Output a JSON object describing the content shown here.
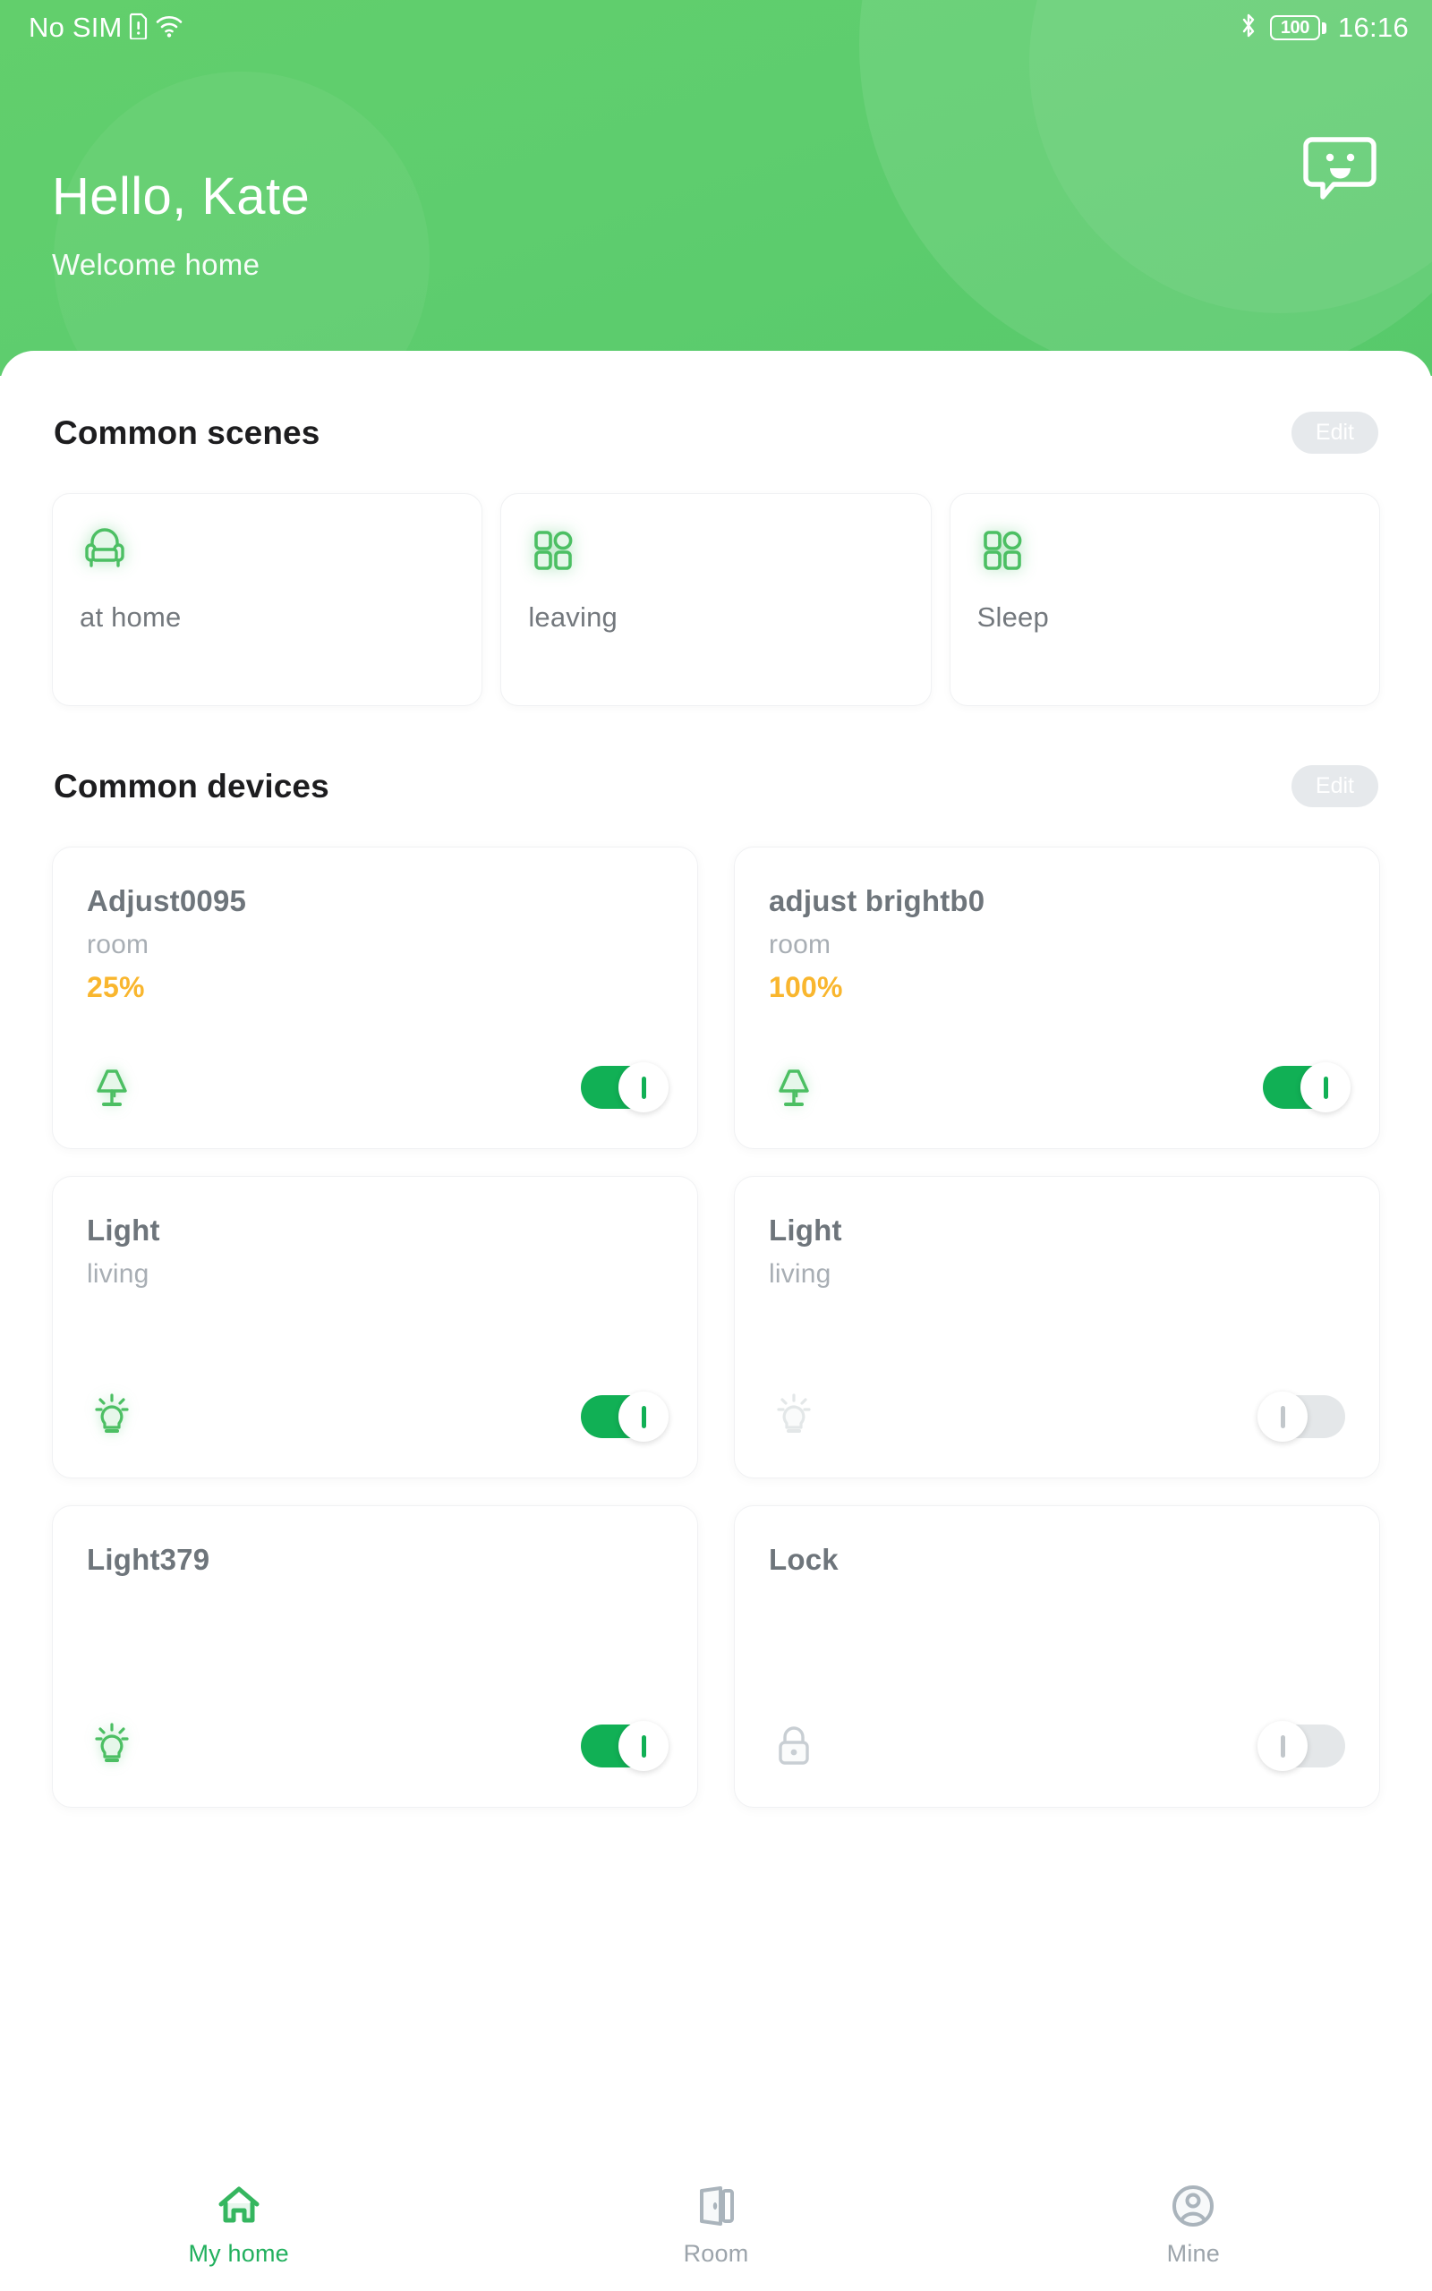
{
  "statusbar": {
    "carrier": "No SIM",
    "sim_icon": "sim-card-alert-icon",
    "wifi_icon": "wifi-icon",
    "bluetooth_icon": "bluetooth-icon",
    "battery_level": "100",
    "battery_icon": "battery-full-icon",
    "time": "16:16"
  },
  "header": {
    "greeting": "Hello, Kate",
    "subtitle": "Welcome home",
    "chat_icon": "chat-smiley-icon",
    "accent_color": "#5ecd6e"
  },
  "scenes_section": {
    "title": "Common scenes",
    "edit_label": "Edit",
    "items": [
      {
        "label": "at home",
        "icon": "armchair-icon"
      },
      {
        "label": "leaving",
        "icon": "grid-scene-icon"
      },
      {
        "label": "Sleep",
        "icon": "grid-scene-icon"
      }
    ]
  },
  "devices_section": {
    "title": "Common devices",
    "edit_label": "Edit",
    "items": [
      {
        "name": "Adjust0095",
        "room": "room",
        "percent": "25%",
        "icon": "table-lamp-icon",
        "state": "on"
      },
      {
        "name": "adjust brightb0",
        "room": "room",
        "percent": "100%",
        "icon": "table-lamp-icon",
        "state": "on"
      },
      {
        "name": "Light",
        "room": "living",
        "percent": "",
        "icon": "light-bulb-icon",
        "state": "on"
      },
      {
        "name": "Light",
        "room": "living",
        "percent": "",
        "icon": "light-bulb-icon",
        "state": "off"
      },
      {
        "name": "Light379",
        "room": "",
        "percent": "",
        "icon": "light-bulb-icon",
        "state": "on"
      },
      {
        "name": "Lock",
        "room": "",
        "percent": "",
        "icon": "lock-icon",
        "state": "off"
      }
    ]
  },
  "bottomnav": {
    "items": [
      {
        "label": "My home",
        "icon": "home-icon",
        "active": true
      },
      {
        "label": "Room",
        "icon": "door-icon",
        "active": false
      },
      {
        "label": "Mine",
        "icon": "person-circle-icon",
        "active": false
      }
    ]
  },
  "colors": {
    "brand_green": "#5ecd6e",
    "toggle_on": "#11b055",
    "percent_amber": "#f9b62e",
    "icon_green": "#4cbf63",
    "icon_grey": "#e3e7e8"
  }
}
